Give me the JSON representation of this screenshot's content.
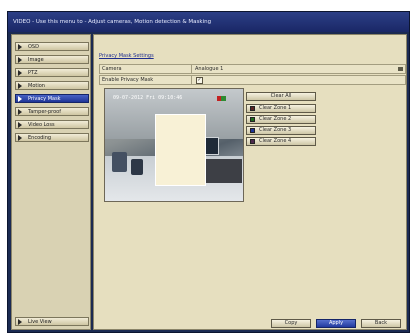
{
  "window": {
    "title": "VIDEO - Use this menu to - Adjust cameras, Motion detection & Masking"
  },
  "sidebar": {
    "items": [
      {
        "label": "OSD",
        "active": false
      },
      {
        "label": "Image",
        "active": false
      },
      {
        "label": "PTZ",
        "active": false
      },
      {
        "label": "Motion",
        "active": false
      },
      {
        "label": "Privacy Mask",
        "active": true
      },
      {
        "label": "Tamper-proof",
        "active": false
      },
      {
        "label": "Video Loss",
        "active": false
      },
      {
        "label": "Encoding",
        "active": false
      }
    ],
    "live_view_label": "Live View"
  },
  "main": {
    "section_title": "Privacy Mask Settings",
    "camera_label": "Camera",
    "camera_value": "Analogue 1",
    "enable_label": "Enable Privacy Mask",
    "enable_checked": true,
    "enable_check_glyph": "✓",
    "osd_time": "09-07-2012 Fri 09:10:46",
    "buttons": {
      "clear_all": "Clear All",
      "zone1": "Clear Zone 1",
      "zone2": "Clear Zone 2",
      "zone3": "Clear Zone 3",
      "zone4": "Clear Zone 4"
    },
    "zone_colors": {
      "zone1": "#5a2424",
      "zone2": "#1e6b1e",
      "zone3": "#1f3597",
      "zone4": "#4d2a4d"
    }
  },
  "footer": {
    "copy": "Copy",
    "apply": "Apply",
    "back": "Back"
  },
  "colors": {
    "accent": "#1f3597",
    "title_bar": "#2c3f86",
    "panel": "#e6dfbf"
  }
}
